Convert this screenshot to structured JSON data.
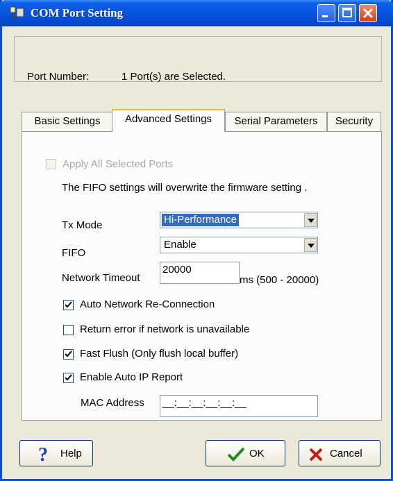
{
  "window": {
    "title": "COM Port Setting"
  },
  "port": {
    "label": "Port Number:",
    "value": "1 Port(s) are Selected."
  },
  "tabs": [
    {
      "label": "Basic Settings"
    },
    {
      "label": "Advanced Settings"
    },
    {
      "label": "Serial Parameters"
    },
    {
      "label": "Security"
    }
  ],
  "advanced": {
    "apply_all": {
      "label": "Apply All Selected Ports",
      "checked": false,
      "enabled": false
    },
    "fifo_note": "The FIFO settings will overwrite the firmware setting .",
    "tx_mode": {
      "label": "Tx Mode",
      "value": "Hi-Performance"
    },
    "fifo": {
      "label": "FIFO",
      "value": "Enable"
    },
    "network_timeout": {
      "label": "Network Timeout",
      "value": "20000",
      "range": "ms (500 - 20000)"
    },
    "auto_reconnect": {
      "label": "Auto Network Re-Connection",
      "checked": true
    },
    "return_error": {
      "label": "Return error if network is unavailable",
      "checked": false
    },
    "fast_flush": {
      "label": "Fast Flush (Only flush local buffer)",
      "checked": true
    },
    "auto_ip_report": {
      "label": "Enable Auto IP Report",
      "checked": true
    },
    "mac_address": {
      "label": "MAC Address",
      "value": "__:__:__:__:__:__"
    }
  },
  "buttons": {
    "help": "Help",
    "ok": "OK",
    "cancel": "Cancel"
  },
  "icons": {
    "help": "question-mark-icon",
    "ok": "checkmark-icon",
    "cancel": "x-icon",
    "app": "com-port-icon"
  },
  "colors": {
    "title_bar": "#0854e0",
    "window_bg": "#ece9d8",
    "selection": "#316ac5"
  }
}
